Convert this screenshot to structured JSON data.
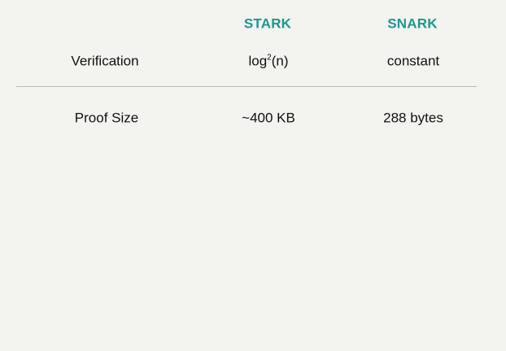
{
  "table": {
    "headers": [
      "STARK",
      "SNARK"
    ],
    "rows": [
      {
        "label": "Verification",
        "stark": {
          "base": "log",
          "sup": "2",
          "rest": "(n)"
        },
        "snark": "constant"
      },
      {
        "label": "Proof Size",
        "stark": "~400 KB",
        "snark": "288 bytes"
      }
    ]
  }
}
